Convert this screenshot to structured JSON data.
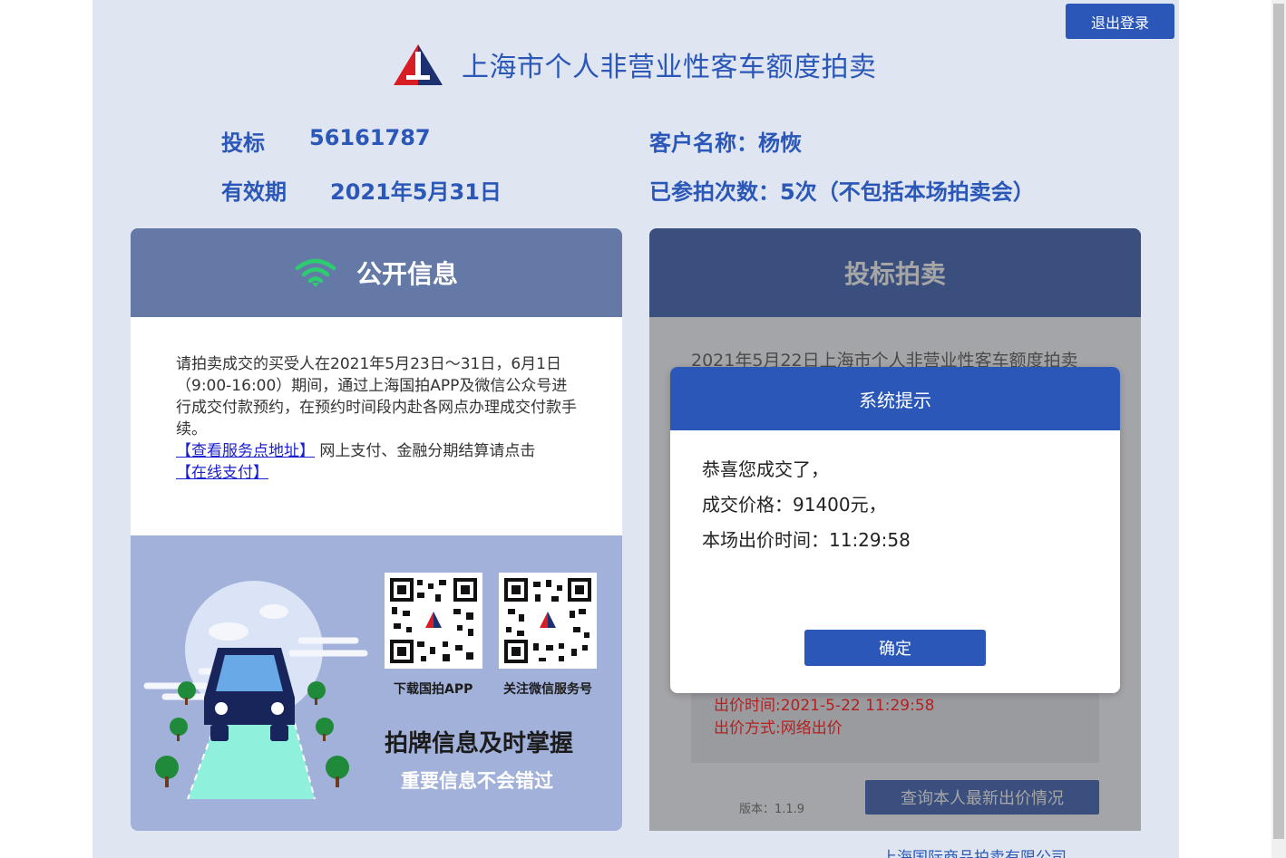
{
  "header": {
    "logout_label": "退出登录",
    "title": "上海市个人非营业性客车额度拍卖"
  },
  "user_info": {
    "bid_label": "投标",
    "bid_number": "56161787",
    "validity_label": "有效期",
    "validity_date": "2021年5月31日",
    "customer_name": "客户名称：杨恢",
    "participation_count": "已参拍次数：5次（不包括本场拍卖会）"
  },
  "public_info": {
    "title": "公开信息",
    "notice_text": "请拍卖成交的买受人在2021年5月23日～31日，6月1日（9:00-16:00）期间，通过上海国拍APP及微信公众号进行成交付款预约，在预约时间段内赴各网点办理成交付款手续。",
    "service_link": "【查看服务点地址】",
    "payment_text": "网上支付、金融分期结算请点击",
    "payment_link": "【在线支付】",
    "qr_app_label": "下载国拍APP",
    "qr_wechat_label": "关注微信服务号",
    "slogan_main": "拍牌信息及时掌握",
    "slogan_sub": "重要信息不会错过"
  },
  "bidding": {
    "title": "投标拍卖",
    "auction_name": "2021年5月22日上海市个人非营业性客车额度拍卖",
    "bid_time": "出价时间:2021-5-22 11:29:58",
    "bid_method": "出价方式:网络出价",
    "version": "版本：1.1.9",
    "query_button": "查询本人最新出价情况"
  },
  "footer": {
    "company": "上海国际商品拍卖有限公司"
  },
  "modal": {
    "title": "系统提示",
    "line1": "恭喜您成交了，",
    "line2": "成交价格：91400元，",
    "line3": "本场出价时间：11:29:58",
    "confirm_label": "确定"
  },
  "colors": {
    "brand_blue": "#2a57b8",
    "page_bg": "#dfe5f1",
    "left_header": "#6479a6",
    "right_header": "#3a4f7e",
    "wifi_green": "#2ecc71",
    "bid_red": "#b52020"
  },
  "icons": {
    "logo": "auction-logo-icon",
    "wifi": "wifi-icon",
    "qr": "qr-code-icon"
  }
}
